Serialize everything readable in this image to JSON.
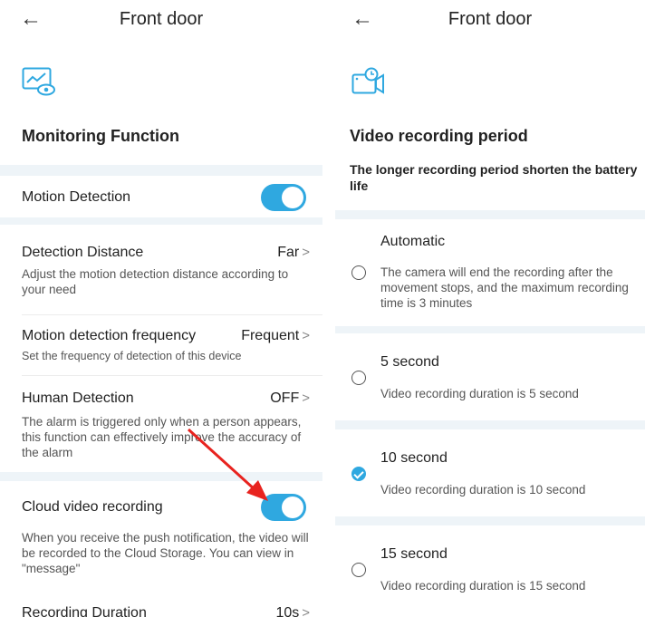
{
  "left": {
    "back_icon": "back-arrow-icon",
    "title": "Front door",
    "hero_icon": "monitoring-chart-eye-icon",
    "section_title": "Monitoring Function",
    "motion_detection": {
      "label": "Motion Detection",
      "enabled": true
    },
    "detection_distance": {
      "label": "Detection Distance",
      "value": "Far",
      "desc": "Adjust the motion detection distance according to your need"
    },
    "motion_frequency": {
      "label": "Motion detection frequency",
      "value": "Frequent",
      "desc": "Set the frequency of detection of this device"
    },
    "human_detection": {
      "label": "Human Detection",
      "value": "OFF",
      "desc": "The alarm is triggered only when a person appears, this function can effectively improve the accuracy of the alarm"
    },
    "cloud_recording": {
      "label": "Cloud video recording",
      "enabled": true,
      "desc": "When you receive the push notification, the video will be recorded to the Cloud Storage. You can view in \"message\""
    },
    "recording_duration": {
      "label": "Recording Duration",
      "value": "10s"
    },
    "chevron": ">"
  },
  "right": {
    "back_icon": "back-arrow-icon",
    "title": "Front door",
    "hero_icon": "video-camera-timer-icon",
    "section_title": "Video recording period",
    "section_sub": "The longer recording period shorten the battery life",
    "options": [
      {
        "label": "Automatic",
        "desc": "The camera will end the recording after the movement stops, and the maximum recording time is 3 minutes",
        "checked": false
      },
      {
        "label": "5 second",
        "desc": "Video recording duration is 5 second",
        "checked": false
      },
      {
        "label": "10 second",
        "desc": "Video recording duration is 10 second",
        "checked": true
      },
      {
        "label": "15 second",
        "desc": "Video recording duration is 15 second",
        "checked": false
      }
    ]
  },
  "colors": {
    "accent": "#2fa8e0",
    "section_band": "#eef4f8",
    "annotation_arrow": "#e8231f"
  }
}
